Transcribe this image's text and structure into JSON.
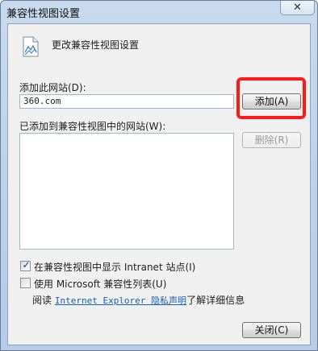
{
  "window": {
    "title": "兼容性视图设置",
    "close_glyph": "✕"
  },
  "header": {
    "icon": "document-settings-icon",
    "text": "更改兼容性视图设置"
  },
  "add_site": {
    "label": "添加此网站(D):",
    "value": "360.com",
    "button_label": "添加(A)"
  },
  "site_list": {
    "label": "已添加到兼容性视图中的网站(W):",
    "items": [],
    "remove_label": "删除(R)"
  },
  "options": {
    "intranet": {
      "checked": true,
      "label": "在兼容性视图中显示 Intranet 站点(I)"
    },
    "ms_list": {
      "checked": false,
      "label": "使用 Microsoft 兼容性列表(U)"
    }
  },
  "privacy": {
    "prefix": "阅读",
    "link": "Internet Explorer 隐私声明",
    "suffix": "了解详细信息"
  },
  "footer": {
    "close_label": "关闭(C)"
  },
  "colors": {
    "highlight": "#ff1a1a",
    "link": "#1a5fb4"
  }
}
